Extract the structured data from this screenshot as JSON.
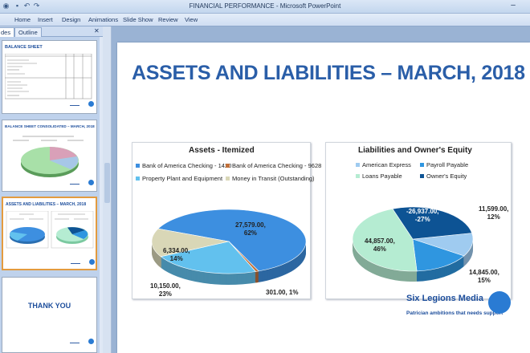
{
  "window": {
    "title": "FINANCIAL PERFORMANCE - Microsoft PowerPoint"
  },
  "ribbon": {
    "tabs": [
      "Home",
      "Insert",
      "Design",
      "Animations",
      "Slide Show",
      "Review",
      "View"
    ]
  },
  "pane": {
    "tabs": [
      "des",
      "Outline"
    ],
    "thumbnails": [
      {
        "title": "BALANCE SHEET"
      },
      {
        "title": "BALANCE SHEET CONSOLIDATED – MARCH, 2018"
      },
      {
        "title": "ASSETS AND LIABILITIES – MARCH, 2018"
      },
      {
        "title": "THANK YOU"
      }
    ]
  },
  "slide": {
    "title": "ASSETS AND LIABILITIES – MARCH, 2018",
    "brand": {
      "name": "Six Legions Media",
      "tagline": "Patrician ambitions that needs support"
    }
  },
  "chart_data": [
    {
      "type": "pie",
      "title": "Assets - Itemized",
      "legend_position": "top",
      "categories": [
        "Bank of America Checking - 1420",
        "Bank of America Checking - 9628",
        "Property Plant and Equipment",
        "Money in Transit (Outstanding)"
      ],
      "values": [
        27579.0,
        301.0,
        10150.0,
        6334.0
      ],
      "data_labels": [
        "27,579.00,\n62%",
        "301.00, 1%",
        "10,150.00,\n23%",
        "6,334.00,\n14%"
      ],
      "colors": [
        "#3d8fe0",
        "#c0703a",
        "#62c1ee",
        "#d9d7b7"
      ]
    },
    {
      "type": "pie",
      "title": "Liabilities and Owner's Equity",
      "legend_position": "top",
      "categories": [
        "American Express",
        "Payroll Payable",
        "Loans Payable",
        "Owner's Equity"
      ],
      "values": [
        11599.0,
        14845.0,
        44857.0,
        -26937.0
      ],
      "data_labels": [
        "11,599.00,\n12%",
        "14,845.00,\n15%",
        "44,857.00,\n46%",
        "-26,937.00,\n-27%"
      ],
      "colors": [
        "#9fcbf0",
        "#2f96e0",
        "#b5ecd2",
        "#0d5394"
      ]
    }
  ]
}
